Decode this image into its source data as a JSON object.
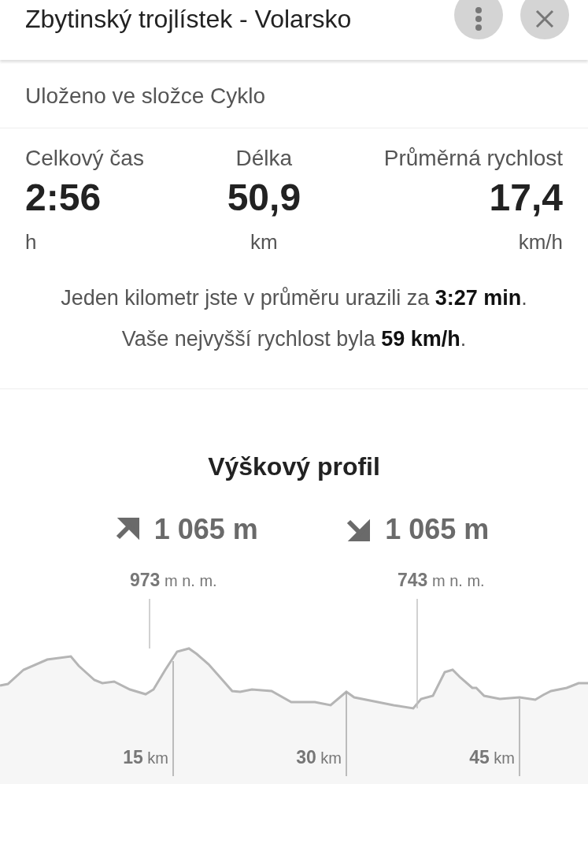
{
  "header": {
    "title": "Zbytinský trojlístek - Volarsko"
  },
  "folder": "Uloženo ve složce Cyklo",
  "stats": [
    {
      "label": "Celkový čas",
      "value": "2:56",
      "unit": "h"
    },
    {
      "label": "Délka",
      "value": "50,9",
      "unit": "km"
    },
    {
      "label": "Průměrná rychlost",
      "value": "17,4",
      "unit": "km/h"
    }
  ],
  "summary": [
    "Jeden kilometr jste v průměru urazili za **3:27 min**.",
    "Vaše nejvyšší rychlost byla **59 km/h**."
  ],
  "elevation": {
    "title": "Výškový profil",
    "ascent": "1 065 m",
    "descent": "1 065 m",
    "peaks": [
      {
        "value": "973",
        "unit": "m n. m."
      },
      {
        "value": "743",
        "unit": "m n. m."
      }
    ],
    "distance_marks": [
      {
        "value": "15",
        "unit": "km"
      },
      {
        "value": "30",
        "unit": "km"
      },
      {
        "value": "45",
        "unit": "km"
      }
    ]
  }
}
